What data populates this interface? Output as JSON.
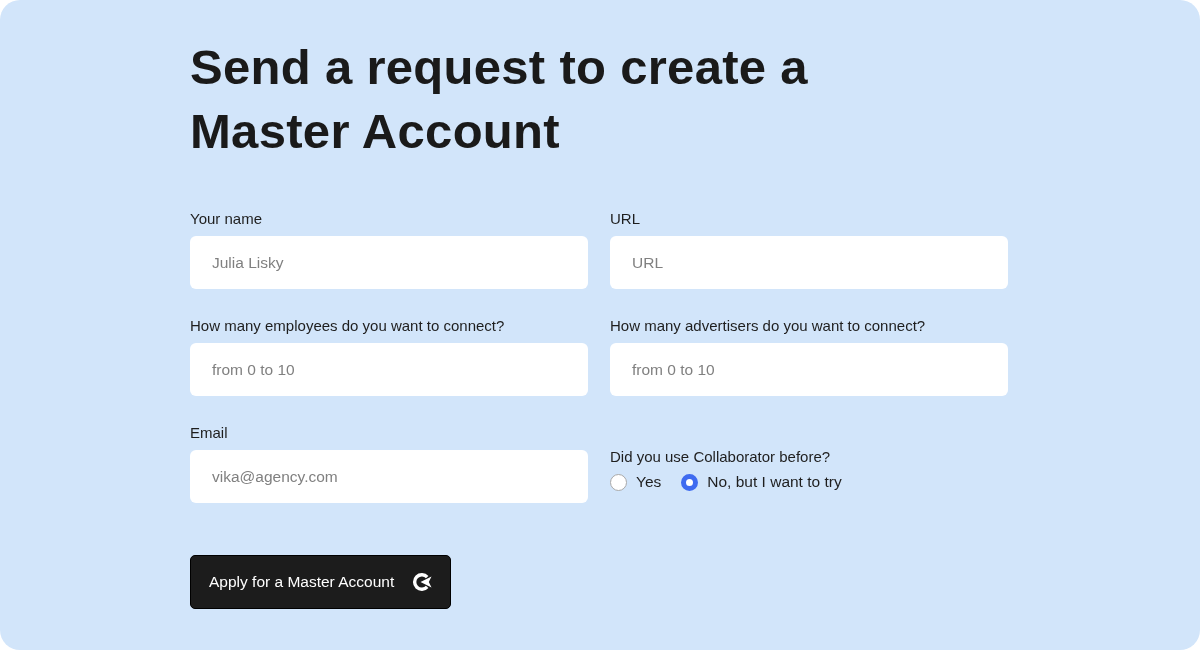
{
  "title": "Send a request to create a Master Account",
  "fields": [
    {
      "kind": "text",
      "label": "Your name",
      "placeholder": "Julia Lisky"
    },
    {
      "kind": "text",
      "label": "URL",
      "placeholder": "URL"
    },
    {
      "kind": "text",
      "label": "How many employees do you want to connect?",
      "placeholder": "from 0 to 10"
    },
    {
      "kind": "text",
      "label": "How many advertisers do you want to connect?",
      "placeholder": "from 0 to 10"
    },
    {
      "kind": "text",
      "label": "Email",
      "placeholder": "vika@agency.com"
    },
    {
      "kind": "radio",
      "label": "Did you use Collaborator before?",
      "options": [
        {
          "label": "Yes",
          "selected": false
        },
        {
          "label": "No, but I want to try",
          "selected": true
        }
      ]
    }
  ],
  "submit_button": {
    "label": "Apply for a Master Account"
  }
}
